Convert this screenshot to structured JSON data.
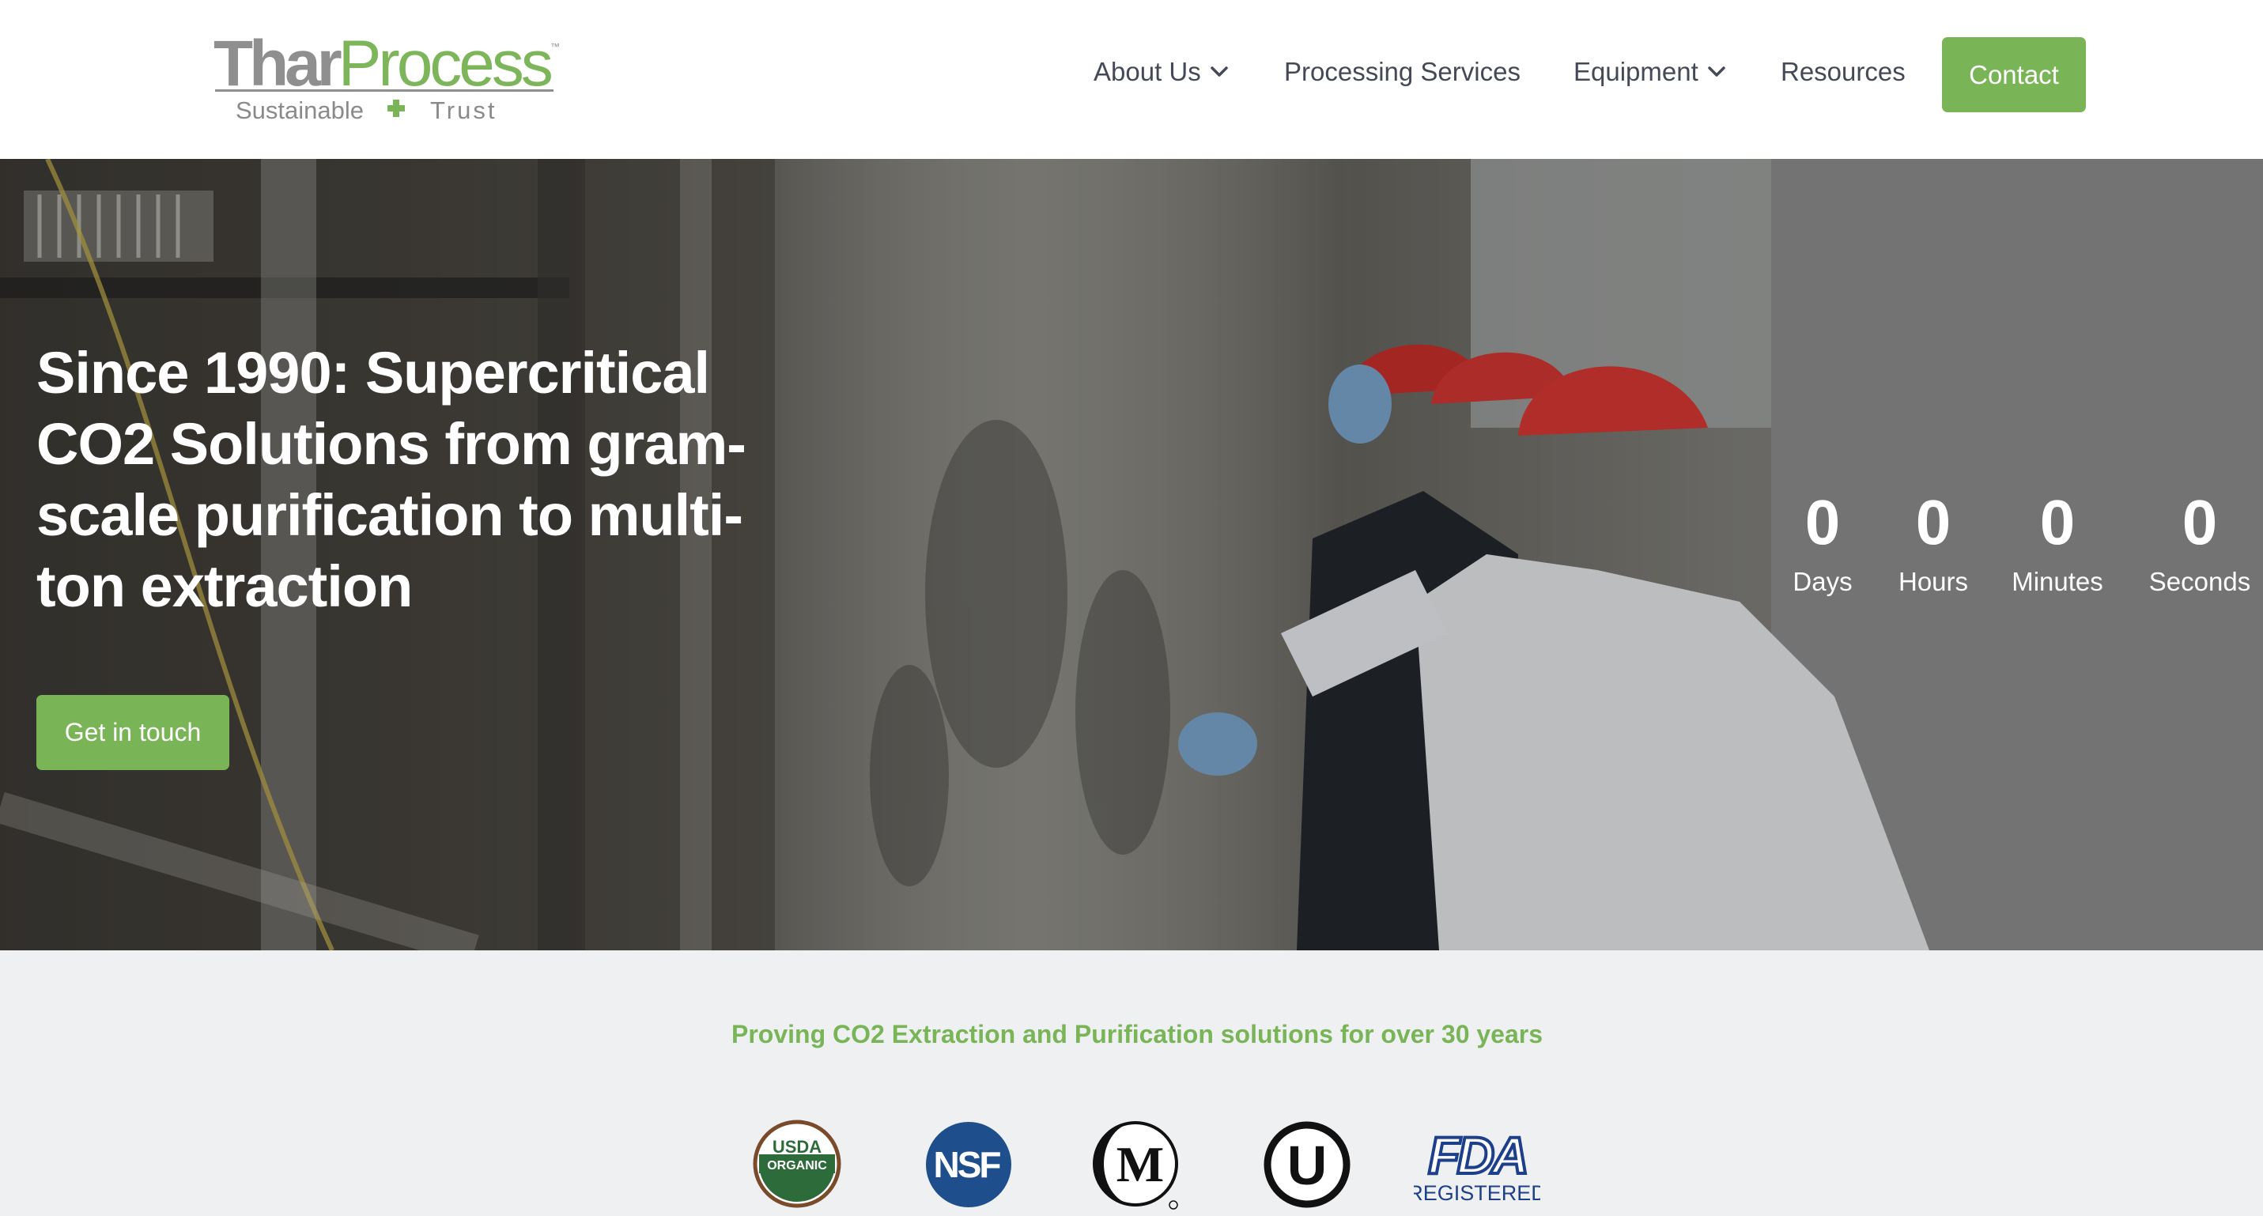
{
  "brand": {
    "logo_main_1": "Thar",
    "logo_main_2": "Process",
    "logo_tm": "™",
    "tagline_left": "Sustainable",
    "tagline_right": "Trust",
    "color_green": "#79b556",
    "color_grey": "#8f8f8f"
  },
  "nav": {
    "items": [
      {
        "label": "About Us",
        "has_dropdown": true
      },
      {
        "label": "Processing Services",
        "has_dropdown": false
      },
      {
        "label": "Equipment",
        "has_dropdown": true
      },
      {
        "label": "Resources",
        "has_dropdown": false
      }
    ],
    "contact_label": "Contact"
  },
  "hero": {
    "title": "Since 1990: Supercritical CO2 Solutions from gram-scale purification to multi-ton extraction",
    "cta_label": "Get in touch",
    "countdown": [
      {
        "value": "0",
        "label": "Days"
      },
      {
        "value": "0",
        "label": "Hours"
      },
      {
        "value": "0",
        "label": "Minutes"
      },
      {
        "value": "0",
        "label": "Seconds"
      }
    ]
  },
  "trust": {
    "headline": "Proving CO2 Extraction and Purification solutions for over 30 years",
    "badges": {
      "usda_top": "USDA",
      "usda_bottom": "ORGANIC",
      "nsf": "NSF",
      "kosher_m": "M",
      "kosher_u": "U",
      "fda_top": "FDA",
      "fda_bottom": "REGISTERED"
    }
  }
}
